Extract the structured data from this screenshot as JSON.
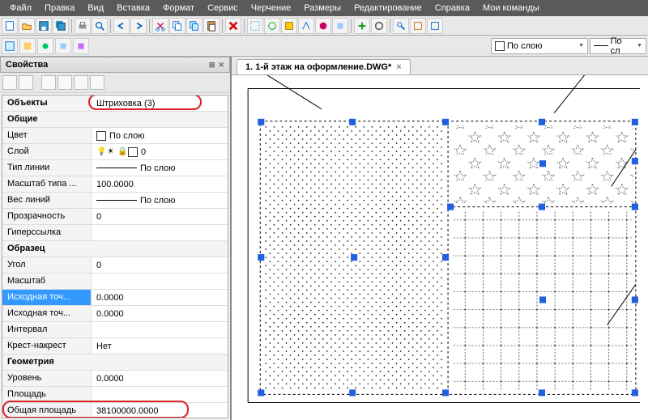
{
  "menu": {
    "file": "Файл",
    "edit": "Правка",
    "view": "Вид",
    "insert": "Вставка",
    "format": "Формат",
    "service": "Сервис",
    "draw": "Черчение",
    "dims": "Размеры",
    "modify": "Редактирование",
    "help": "Справка",
    "mycmds": "Мои команды"
  },
  "toolbar2": {
    "layer_dd": "По слою",
    "linetype_dd": "По сл"
  },
  "props": {
    "title": "Свойства",
    "objects_label": "Объекты",
    "objects_value": "Штриховка (3)",
    "section_general": "Общие",
    "color_label": "Цвет",
    "color_value": "По слою",
    "layer_label": "Слой",
    "layer_value": "0",
    "linetype_label": "Тип линии",
    "linetype_value": "По слою",
    "ltscale_label": "Масштаб типа ...",
    "ltscale_value": "100.0000",
    "lweight_label": "Вес линий",
    "lweight_value": "По слою",
    "transparency_label": "Прозрачность",
    "transparency_value": "0",
    "hyperlink_label": "Гиперссылка",
    "hyperlink_value": "",
    "section_pattern": "Образец",
    "angle_label": "Угол",
    "angle_value": "0",
    "scale_label": "Масштаб",
    "scale_value": "",
    "origin_x_label": "Исходная точ...",
    "origin_x_value": "0.0000",
    "origin_y_label": "Исходная точ...",
    "origin_y_value": "0.0000",
    "spacing_label": "Интервал",
    "spacing_value": "",
    "double_label": "Крест-накрест",
    "double_value": "Нет",
    "section_geometry": "Геометрия",
    "elevation_label": "Уровень",
    "elevation_value": "0.0000",
    "area_label": "Площадь",
    "area_value": "",
    "total_area_label": "Общая площадь",
    "total_area_value": "38100000.0000"
  },
  "doc": {
    "tab_label": "1. 1-й этаж на оформление.DWG*"
  }
}
